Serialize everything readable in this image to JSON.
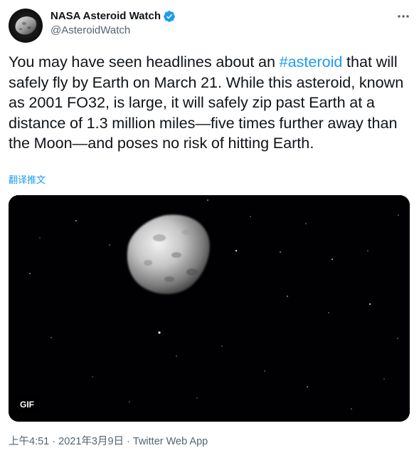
{
  "author": {
    "name": "NASA Asteroid Watch",
    "handle": "@AsteroidWatch",
    "verified": true
  },
  "tweet": {
    "text_before": "You may have seen headlines about an ",
    "hashtag": "#asteroid",
    "text_after": " that will safely fly by Earth on March 21. While this asteroid, known as 2001 FO32, is large, it will safely zip past Earth at a distance of 1.3 million miles—five times further away than the Moon—and poses no risk of hitting Earth.",
    "translate_label": "翻译推文"
  },
  "media": {
    "badge": "GIF",
    "icon": "asteroid-gif"
  },
  "meta": {
    "time": "上午4:51",
    "separator1": " · ",
    "date": "2021年3月9日",
    "separator2": " · ",
    "source": "Twitter Web App"
  },
  "colors": {
    "accent": "#1d9bf0",
    "text": "#0f1419",
    "secondary": "#536471",
    "media_bg": "#010103"
  }
}
